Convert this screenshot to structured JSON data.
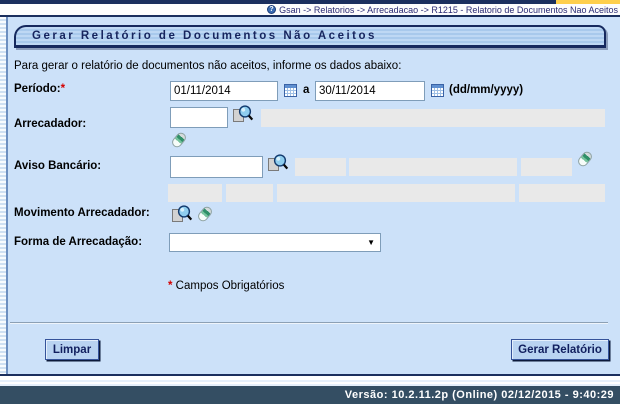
{
  "breadcrumb": {
    "text": "Gsan -> Relatorios -> Arrecadacao -> R1215 - Relatorio de Documentos Nao Aceitos"
  },
  "icons": {
    "help_glyph": "?",
    "dropdown_glyph": "▼"
  },
  "title": "Gerar Relatório de Documentos Não Aceitos",
  "instruction": "Para gerar o relatório de documentos não aceitos, informe os dados abaixo:",
  "form": {
    "periodo": {
      "label": "Período:",
      "required_mark": "*",
      "start_value": "01/11/2014",
      "separator": "a",
      "end_value": "30/11/2014",
      "format_hint": "(dd/mm/yyyy)"
    },
    "arrecadador": {
      "label": "Arrecadador:",
      "value": "",
      "description": ""
    },
    "aviso_bancario": {
      "label": "Aviso Bancário:",
      "value": ""
    },
    "movimento_arrecadador": {
      "label": "Movimento Arrecadador:"
    },
    "forma_arrecadacao": {
      "label": "Forma de Arrecadação:",
      "selected": ""
    }
  },
  "required_note": {
    "mark": "*",
    "text": " Campos Obrigatórios"
  },
  "buttons": {
    "limpar": "Limpar",
    "gerar": "Gerar Relatório"
  },
  "footer": {
    "version_text": "Versão: 10.2.11.2p (Online) 02/12/2015 - 9:40:29"
  },
  "colors": {
    "navy": "#1b2f5e",
    "content_bg": "#cce1f9",
    "highlight_yellow": "#fecf4d",
    "readonly_gray": "#e9e9e9",
    "footer_bg": "#344e63",
    "required_red": "#d40000"
  }
}
